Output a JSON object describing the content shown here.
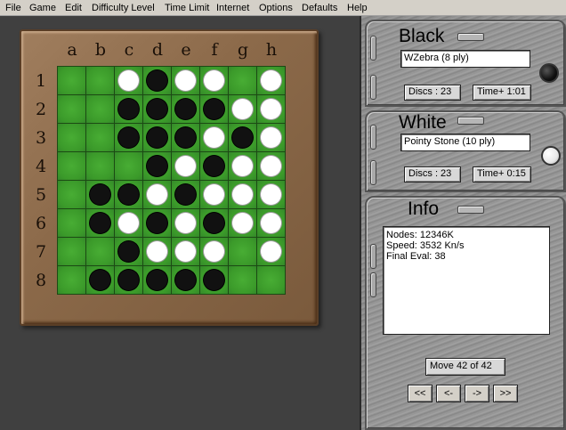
{
  "menu": [
    "File",
    "Game",
    "Edit",
    "Difficulty Level",
    "Time Limit",
    "Internet",
    "Options",
    "Defaults",
    "Help"
  ],
  "board": {
    "columns": [
      "a",
      "b",
      "c",
      "d",
      "e",
      "f",
      "g",
      "h"
    ],
    "rows": [
      "1",
      "2",
      "3",
      "4",
      "5",
      "6",
      "7",
      "8"
    ],
    "cells": [
      [
        "",
        "",
        "W",
        "B",
        "W",
        "W",
        "",
        "W"
      ],
      [
        "",
        "",
        "B",
        "B",
        "B",
        "B",
        "W",
        "W"
      ],
      [
        "",
        "",
        "B",
        "B",
        "B",
        "W",
        "B",
        "W"
      ],
      [
        "",
        "",
        "",
        "B",
        "W",
        "B",
        "W",
        "W"
      ],
      [
        "",
        "B",
        "B",
        "W",
        "B",
        "W",
        "W",
        "W"
      ],
      [
        "",
        "B",
        "W",
        "B",
        "W",
        "B",
        "W",
        "W"
      ],
      [
        "",
        "",
        "B",
        "W",
        "W",
        "W",
        "",
        "W"
      ],
      [
        "",
        "B",
        "B",
        "B",
        "B",
        "B",
        "",
        ""
      ]
    ],
    "colors": {
      "felt": "#3b9a2a",
      "black_disc": "#111111",
      "white_disc": "#ffffff",
      "frame": "#8c6a4a"
    }
  },
  "black": {
    "title": "Black",
    "player": "WZebra (8 ply)",
    "discs": "Discs : 23",
    "time": "Time+ 1:01",
    "indicator": "black-disc-icon"
  },
  "white": {
    "title": "White",
    "player": "Pointy Stone (10 ply)",
    "discs": "Discs : 23",
    "time": "Time+ 0:15",
    "indicator": "white-disc-icon"
  },
  "info": {
    "title": "Info",
    "lines": [
      "Nodes: 12346K",
      "Speed: 3532 Kn/s",
      "Final Eval: 38"
    ],
    "move": "Move 42 of 42"
  },
  "nav": {
    "first": "<<",
    "prev": "<-",
    "next": "->",
    "last": ">>"
  }
}
